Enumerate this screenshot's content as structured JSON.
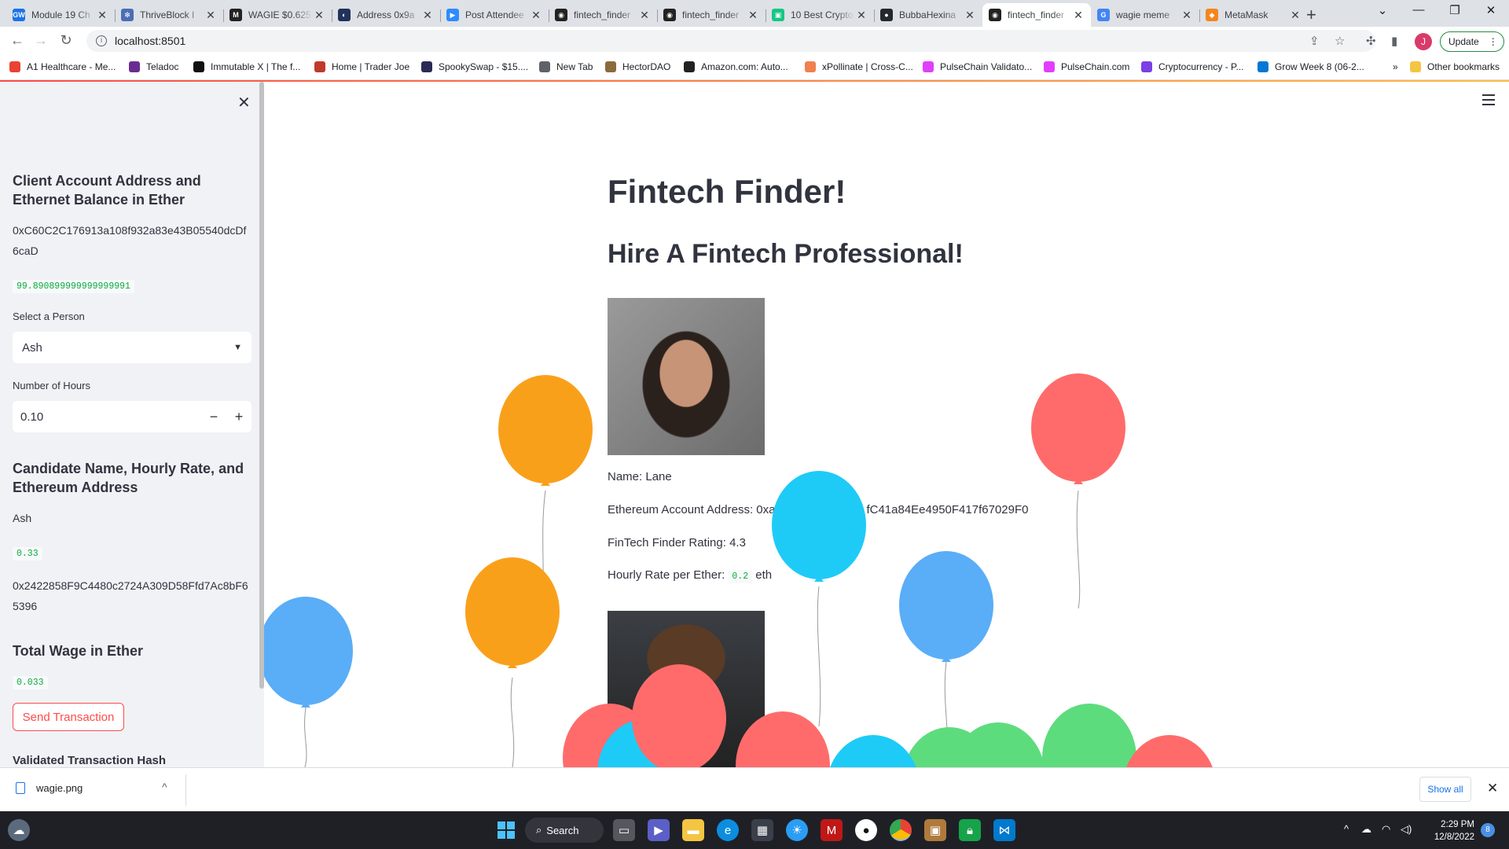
{
  "browser": {
    "tabs": [
      {
        "title": "Module 19 Ch",
        "fav": "#1a73e8",
        "glyph": "GW"
      },
      {
        "title": "ThriveBlock I",
        "fav": "#4a6fb5",
        "glyph": "✻"
      },
      {
        "title": "WAGIE $0.625",
        "fav": "#222222",
        "glyph": "M"
      },
      {
        "title": "Address 0x9a",
        "fav": "#21325b",
        "glyph": "◐"
      },
      {
        "title": "Post Attendee",
        "fav": "#2d8cff",
        "glyph": "▶"
      },
      {
        "title": "fintech_finder",
        "fav": "#222222",
        "glyph": "◉"
      },
      {
        "title": "fintech_finder",
        "fav": "#222222",
        "glyph": "◉"
      },
      {
        "title": "10 Best Crypto",
        "fav": "#16c784",
        "glyph": "▣"
      },
      {
        "title": "BubbaHexina",
        "fav": "#24292f",
        "glyph": "●"
      },
      {
        "title": "fintech_finder",
        "fav": "#222222",
        "glyph": "◉"
      },
      {
        "title": "wagie meme",
        "fav": "#4285f4",
        "glyph": "G"
      },
      {
        "title": "MetaMask",
        "fav": "#f6851b",
        "glyph": "◆"
      }
    ],
    "active_tab_index": 9,
    "url": "localhost:8501",
    "update_label": "Update",
    "profile_initial": "J",
    "bookmarks": [
      {
        "label": "A1 Healthcare - Me...",
        "color": "#e94235"
      },
      {
        "label": "Teladoc",
        "color": "#6a2c91"
      },
      {
        "label": "Immutable X | The f...",
        "color": "#111111"
      },
      {
        "label": "Home | Trader Joe",
        "color": "#c0392b"
      },
      {
        "label": "SpookySwap - $15....",
        "color": "#2b2b55"
      },
      {
        "label": "New Tab",
        "color": "#5f6368"
      },
      {
        "label": "HectorDAO",
        "color": "#8b6a3d"
      },
      {
        "label": "Amazon.com: Auto...",
        "color": "#222222"
      },
      {
        "label": "xPollinate | Cross-C...",
        "color": "#f08050"
      },
      {
        "label": "PulseChain Validato...",
        "color": "#e040fb"
      },
      {
        "label": "PulseChain.com",
        "color": "#e040fb"
      },
      {
        "label": "Cryptocurrency - P...",
        "color": "#7b3fe4"
      },
      {
        "label": "Grow Week 8 (06-2...",
        "color": "#0078d4"
      }
    ],
    "bookmarks_more": "»",
    "other_bookmarks": "Other bookmarks"
  },
  "sidebar": {
    "account_heading": "Client Account Address and Ethernet Balance in Ether",
    "account_address": "0xC60C2C176913a108f932a83e43B05540dcDf6caD",
    "account_balance": "99.890899999999999991",
    "select_label": "Select a Person",
    "select_value": "Ash",
    "hours_label": "Number of Hours",
    "hours_value": "0.10",
    "candidate_heading": "Candidate Name, Hourly Rate, and Ethereum Address",
    "candidate_name": "Ash",
    "candidate_rate": "0.33",
    "candidate_address": "0x2422858F9C4480c2724A309D58Ffd7Ac8bF65396",
    "wage_heading": "Total Wage in Ether",
    "wage_value": "0.033",
    "send_button": "Send Transaction",
    "validated_heading": "Validated Transaction Hash"
  },
  "main": {
    "title": "Fintech Finder!",
    "subtitle": "Hire A Fintech Professional!",
    "candidate": {
      "name_line": "Name: Lane",
      "address_prefix": "Ethereum Account Address: 0xa",
      "address_suffix": "fC41a84Ee4950F417f67029F0",
      "rating_line": "FinTech Finder Rating: 4.3",
      "rate_label": "Hourly Rate per Ether:",
      "rate_value": "0.2",
      "rate_unit": "eth"
    }
  },
  "download": {
    "filename": "wagie.png",
    "show_all": "Show all"
  },
  "taskbar": {
    "search_label": "Search",
    "time": "2:29 PM",
    "date": "12/8/2022",
    "notifications": "8"
  },
  "colors": {
    "balloon_orange": "#f9a01b",
    "balloon_red": "#ff6b6b",
    "balloon_cyan": "#1ecbf7",
    "balloon_blue": "#5aadf7",
    "balloon_green": "#5ddc7d",
    "streamlit_red": "#ff4b4b"
  }
}
